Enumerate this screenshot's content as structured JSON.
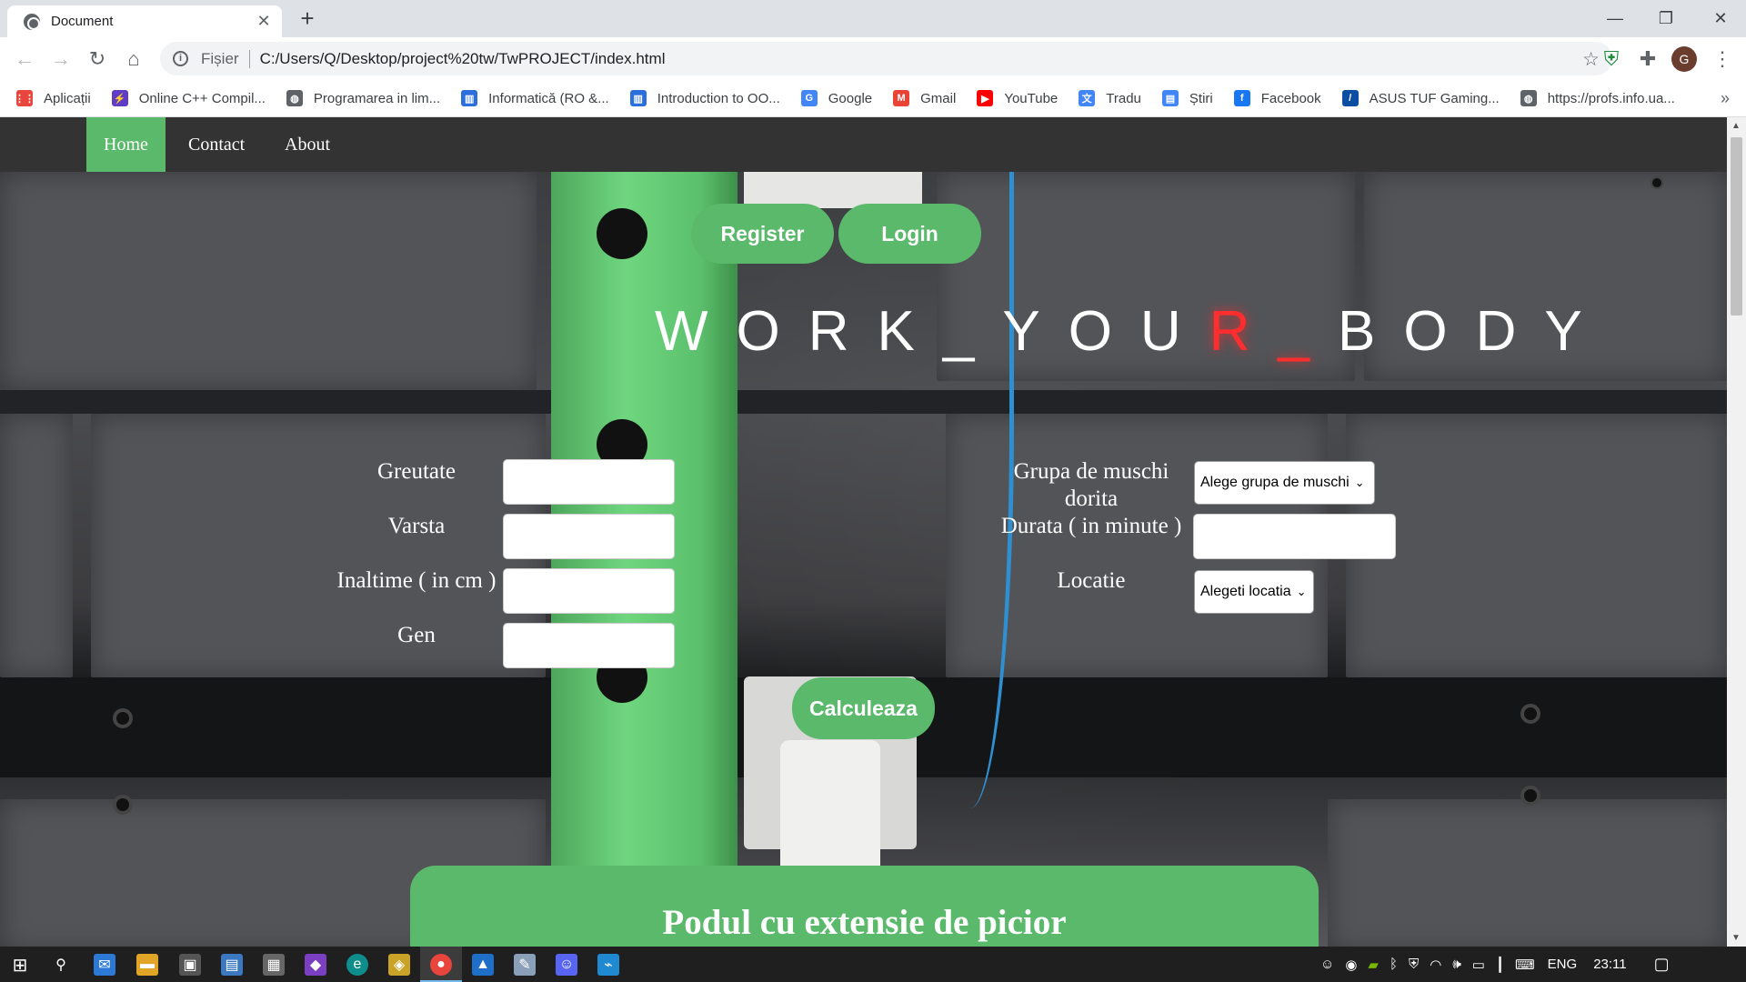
{
  "browser": {
    "tab_title": "Document",
    "url_scheme": "Fișier",
    "url": "C:/Users/Q/Desktop/project%20tw/TwPROJECT/index.html",
    "avatar_letter": "G",
    "bookmarks": [
      {
        "label": "Aplicații",
        "icon": "apps-grid-icon",
        "color": "#e8453c"
      },
      {
        "label": "Online C++ Compil...",
        "icon": "bolt-icon",
        "color": "#5f3dc4"
      },
      {
        "label": "Programarea in lim...",
        "icon": "globe-icon",
        "color": "#5f6368"
      },
      {
        "label": "Informatică (RO &...",
        "icon": "chart-icon",
        "color": "#2a6fdb"
      },
      {
        "label": "Introduction to OO...",
        "icon": "chart-icon",
        "color": "#2a6fdb"
      },
      {
        "label": "Google",
        "icon": "google-icon",
        "color": "#4285f4"
      },
      {
        "label": "Gmail",
        "icon": "gmail-icon",
        "color": "#ea4335"
      },
      {
        "label": "YouTube",
        "icon": "youtube-icon",
        "color": "#ff0000"
      },
      {
        "label": "Tradu",
        "icon": "translate-icon",
        "color": "#4285f4"
      },
      {
        "label": "Știri",
        "icon": "news-icon",
        "color": "#4285f4"
      },
      {
        "label": "Facebook",
        "icon": "facebook-icon",
        "color": "#1877f2"
      },
      {
        "label": "ASUS TUF Gaming...",
        "icon": "asus-icon",
        "color": "#0b4ea2"
      },
      {
        "label": "https://profs.info.ua...",
        "icon": "globe-icon",
        "color": "#5f6368"
      }
    ]
  },
  "nav": {
    "home": "Home",
    "contact": "Contact",
    "about": "About"
  },
  "hero": {
    "register": "Register",
    "login": "Login",
    "headline_part1": "WORK_YOU",
    "headline_red": "R_",
    "headline_part2": "BODY"
  },
  "form": {
    "greutate": "Greutate",
    "varsta": "Varsta",
    "inaltime": "Inaltime ( in cm )",
    "gen": "Gen",
    "grupa_line1": "Grupa de muschi",
    "grupa_line2": "dorita",
    "grupa_select": "Alege grupa de muschi",
    "durata": "Durata ( in minute )",
    "locatie": "Locatie",
    "locatie_select": "Alegeti locatia",
    "submit": "Calculeaza"
  },
  "card": {
    "title": "Podul cu extensie de picior"
  },
  "taskbar": {
    "language": "ENG",
    "time": "23:11"
  },
  "colors": {
    "accent": "#5ab96b",
    "navbar": "#333333",
    "headline_red": "#ff2e2e"
  }
}
